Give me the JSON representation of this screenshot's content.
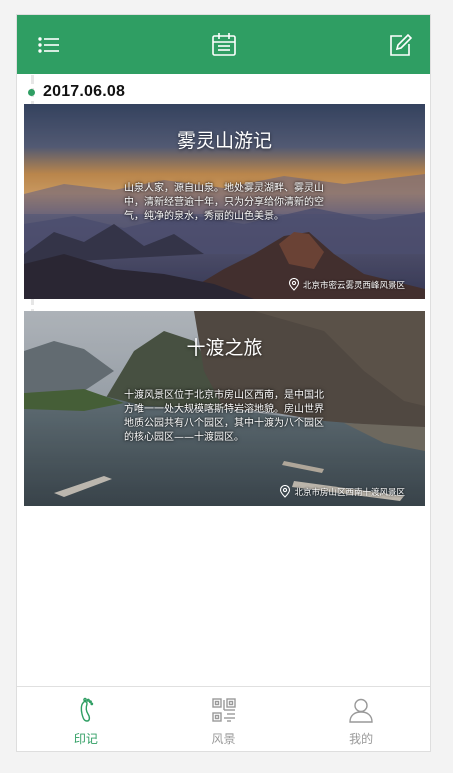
{
  "header": {
    "menu_icon": "list-menu-icon",
    "center_icon": "calendar-icon",
    "right_icon": "edit-icon",
    "color": "#2f9e63"
  },
  "timeline": {
    "date": "2017.06.08"
  },
  "cards": [
    {
      "title": "雾灵山游记",
      "description": "山泉人家，源自山泉。地处雾灵湖畔、雾灵山中，清新经营逾十年，只为分享给你清新的空气，纯净的泉水，秀丽的山色美景。",
      "location": "北京市密云雾灵西峰风景区",
      "location_icon": "location-pin-icon"
    },
    {
      "title": "十渡之旅",
      "description": "十渡风景区位于北京市房山区西南，是中国北方唯一一处大规模喀斯特岩溶地貌。房山世界地质公园共有八个园区，其中十渡为八个园区的核心园区——十渡园区。",
      "location": "北京市房山区西南十渡风景区",
      "location_icon": "location-pin-icon"
    }
  ],
  "tabbar": {
    "items": [
      {
        "label": "印记",
        "icon": "footprint-icon",
        "active": true
      },
      {
        "label": "风景",
        "icon": "scenery-grid-icon",
        "active": false
      },
      {
        "label": "我的",
        "icon": "user-icon",
        "active": false
      }
    ],
    "active_color": "#2f9e63",
    "inactive_color": "#999999"
  }
}
